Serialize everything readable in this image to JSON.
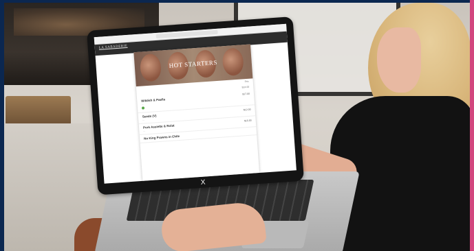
{
  "site": {
    "brand": "LA SABADERIE",
    "hero_title": "HOT STARTERS",
    "close_symbol": "X"
  },
  "menu": {
    "top_line_1": "Prix",
    "top_line_2": "$24.00",
    "items": [
      {
        "name": "Wildish & Paella",
        "desc": "...",
        "price": "$17.00"
      },
      {
        "name": "Seeds (V)",
        "desc": "...",
        "price": "$12.00"
      },
      {
        "name": "Pork Assiette & Rolat",
        "desc": "...",
        "price": "$15.00"
      },
      {
        "name": "No King Prawns in Chile",
        "desc": "...",
        "price": ""
      }
    ]
  }
}
